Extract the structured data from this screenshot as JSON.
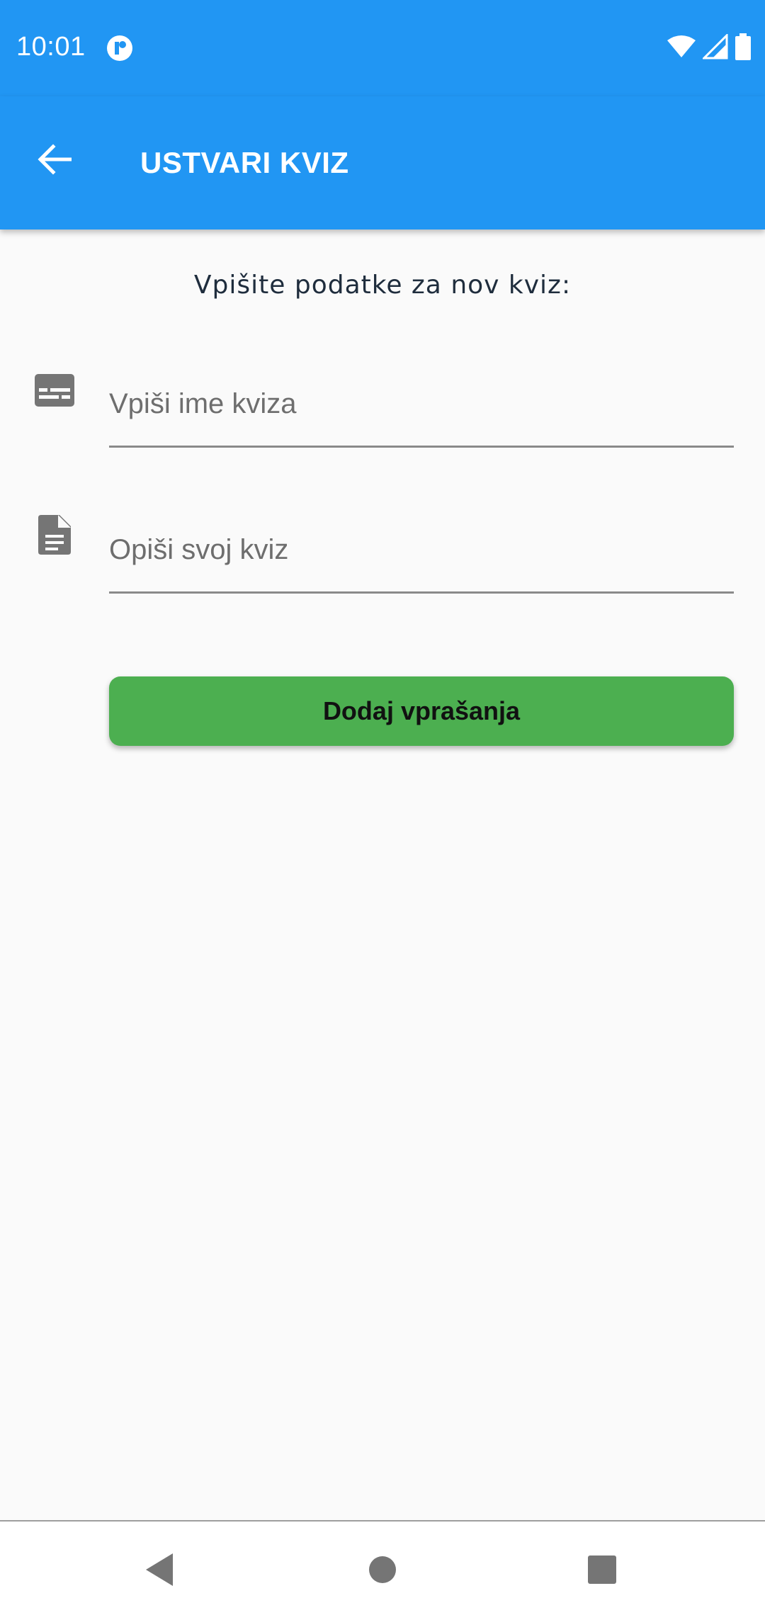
{
  "status_bar": {
    "time": "10:01"
  },
  "app_bar": {
    "title": "USTVARI KVIZ"
  },
  "content": {
    "subtitle": "Vpišite podatke za nov kviz:",
    "name_field": {
      "placeholder": "Vpiši ime kviza",
      "value": "",
      "icon": "subtitles-icon"
    },
    "description_field": {
      "placeholder": "Opiši svoj kviz",
      "value": "",
      "icon": "document-icon"
    },
    "add_button_label": "Dodaj vprašanja"
  },
  "colors": {
    "primary": "#2196f3",
    "button": "#4caf50",
    "background": "#fafafa"
  }
}
